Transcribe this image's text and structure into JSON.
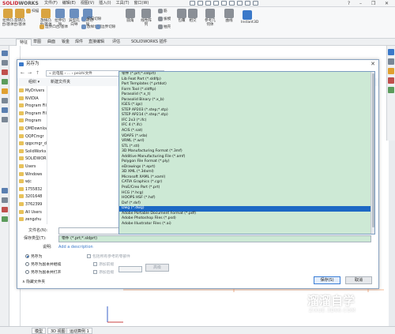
{
  "app": {
    "brand_primary": "SOLID",
    "brand_secondary": "WORKS"
  },
  "menubar": [
    "文件(F)",
    "编辑(E)",
    "视图(V)",
    "插入(I)",
    "工具(T)",
    "窗口(W)"
  ],
  "ribbon": {
    "buttons": [
      {
        "label": "拉伸凸台/基体",
        "color": "#d9a441"
      },
      {
        "label": "旋转凸台/基体",
        "color": "#d9a441"
      },
      {
        "label": "扫描",
        "color": "#d9a441"
      },
      {
        "label": "放样凸台/基体",
        "color": "#d9a441"
      },
      {
        "label": "边界凸台/基体",
        "color": "#d9a441"
      },
      {
        "label": "拉伸切除",
        "color": "#6b8fbf"
      },
      {
        "label": "异型孔向导",
        "color": "#6b8fbf"
      },
      {
        "label": "旋转切除",
        "color": "#6b8fbf"
      },
      {
        "label": "扫描切除",
        "color": "#6b8fbf"
      },
      {
        "label": "放样切割",
        "color": "#6b8fbf"
      },
      {
        "label": "边界切除",
        "color": "#6b8fbf"
      },
      {
        "label": "圆角",
        "color": "#8a8f96"
      },
      {
        "label": "线性阵列",
        "color": "#8a8f96"
      },
      {
        "label": "筋",
        "color": "#8a8f96"
      },
      {
        "label": "拔模",
        "color": "#8a8f96"
      },
      {
        "label": "抽壳",
        "color": "#8a8f96"
      },
      {
        "label": "包覆",
        "color": "#8a8f96"
      },
      {
        "label": "相交",
        "color": "#8a8f96"
      },
      {
        "label": "参考几何体",
        "color": "#8a8f96"
      },
      {
        "label": "曲线",
        "color": "#8a8f96"
      },
      {
        "label": "Instant3D",
        "color": "#3b79c9"
      }
    ]
  },
  "command_tabs": [
    "特征",
    "草图",
    "曲面",
    "钣金",
    "焊件",
    "直接编辑",
    "评估",
    "SOLIDWORKS 插件"
  ],
  "dialog": {
    "title": "另存为",
    "address": "« 此电脑 › ... › peizhi文件",
    "cmd_organize": "组织 ▾",
    "cmd_newfolder": "新建文件夹",
    "folders": [
      "MyDrivers",
      "NVIDIA",
      "Program Files",
      "Program Files (x86)",
      "Program",
      "QMDownload",
      "QQPCmgr",
      "qqpcmgr_docpro",
      "SolidWorks",
      "SOLIDWORKS",
      "Users",
      "Windows",
      "wjc",
      "1755832",
      "3201648",
      "3762399",
      "All Users",
      "zengzhu"
    ],
    "filename_label": "文件名(N):",
    "filetype_label": "保存类型(T):",
    "filetype_value": "零件 (*.prt;*.sldprt)",
    "description_label": "说明:",
    "description_placeholder": "Add a description",
    "types": [
      "零件 (*.prt;*.sldprt)",
      "Lib Feat Part (*.sldlfp)",
      "Part Templates (*.prtdot)",
      "Form Tool (*.sldftp)",
      "Parasolid (*.x_t)",
      "Parasolid Binary (*.x_b)",
      "IGES (*.igs)",
      "STEP AP203 (*.step;*.stp)",
      "STEP AP214 (*.step;*.stp)",
      "IFC 2x3 (*.ifc)",
      "IFC 4 (*.ifc)",
      "ACIS (*.sat)",
      "VDAFS (*.vda)",
      "VRML (*.wrl)",
      "STL (*.stl)",
      "3D Manufacturing Format (*.3mf)",
      "Additive Manufacturing File (*.amf)",
      "Polygon File Format (*.ply)",
      "eDrawings (*.eprt)",
      "3D XML (*.3dxml)",
      "Microsoft XAML (*.xaml)",
      "CATIA Graphics (*.cgr)",
      "ProE/Creo Part (*.prt)",
      "HCG (*.hcg)",
      "HOOPS HSF (*.hsf)",
      "Dxf (*.dxf)",
      "Dwg (*.dwg)",
      "Adobe Portable Document Format (*.pdf)",
      "Adobe Photoshop Files (*.psd)",
      "Adobe Illustrator Files (*.ai)"
    ],
    "selected_type": "Dwg (*.dwg)",
    "options": {
      "save_as": "另存为",
      "save_as_copy_continue": "另存为副本并继续",
      "save_as_copy_open": "另存为副本并打开",
      "include_refs": "包括所有参考的零部件",
      "add_prefix": "添加前缀",
      "add_suffix": "添加后缀",
      "advanced": "高级"
    },
    "hide_folders": "隐藏文件夹",
    "save_button": "保存(S)",
    "cancel_button": "取消"
  },
  "status_tabs": [
    "模型",
    "3D 视图",
    "运动算例 1"
  ],
  "watermark": {
    "title": "溜溜自学",
    "subtitle": "ZIXUE.3D66.COM"
  }
}
